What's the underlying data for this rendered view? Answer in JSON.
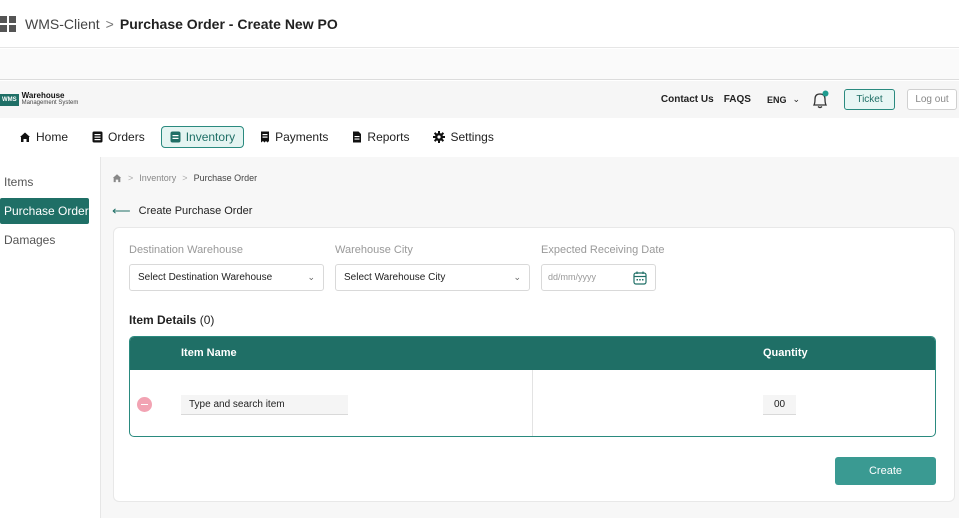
{
  "titlebar": {
    "app": "WMS-Client",
    "separator": ">",
    "page": "Purchase Order - Create New PO"
  },
  "brand": {
    "badge": "WMS",
    "line1": "Warehouse",
    "line2": "Management System"
  },
  "topbar": {
    "contact": "Contact Us",
    "faqs": "FAQS",
    "language": "ENG",
    "ticket": "Ticket",
    "logout": "Log out"
  },
  "nav": [
    {
      "label": "Home",
      "icon": "home-icon"
    },
    {
      "label": "Orders",
      "icon": "orders-icon"
    },
    {
      "label": "Inventory",
      "icon": "inventory-icon",
      "active": true
    },
    {
      "label": "Payments",
      "icon": "payments-icon"
    },
    {
      "label": "Reports",
      "icon": "reports-icon"
    },
    {
      "label": "Settings",
      "icon": "gear-icon"
    }
  ],
  "sidebar": [
    {
      "label": "Items"
    },
    {
      "label": "Purchase Order",
      "active": true
    },
    {
      "label": "Damages"
    }
  ],
  "breadcrumb": {
    "items": [
      "Inventory",
      "Purchase Order"
    ],
    "separator": ">"
  },
  "page": {
    "title": "Create Purchase Order"
  },
  "form": {
    "destination_label": "Destination Warehouse",
    "destination_value": "Select Destination Warehouse",
    "city_label": "Warehouse City",
    "city_value": "Select Warehouse City",
    "date_label": "Expected Receiving Date",
    "date_placeholder": "dd/mm/yyyy"
  },
  "items": {
    "title": "Item Details",
    "count": "(0)",
    "columns": [
      "Item Name",
      "Quantity"
    ],
    "row": {
      "item_placeholder": "Type and search item",
      "quantity": "00"
    }
  },
  "actions": {
    "create": "Create"
  },
  "colors": {
    "primary": "#1f6f66",
    "accent": "#3a9a92",
    "remove": "#f2a3b3",
    "notification": "#1f9c8f"
  }
}
